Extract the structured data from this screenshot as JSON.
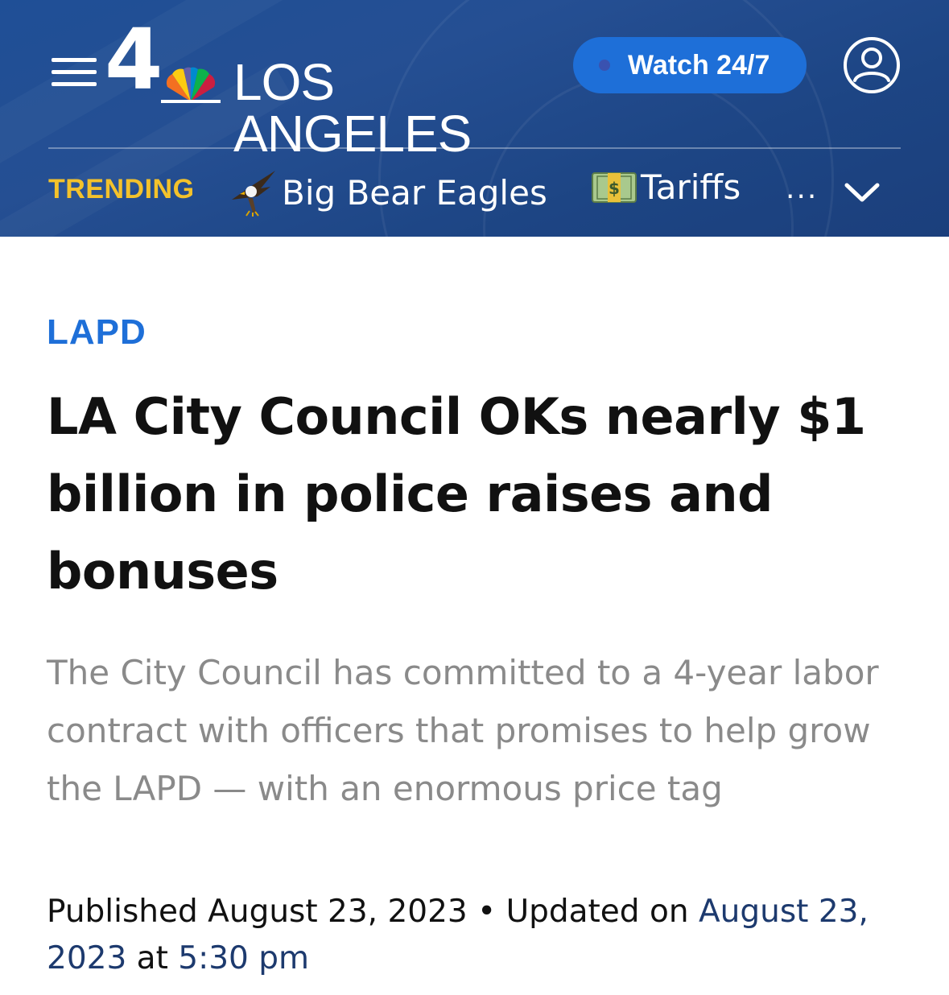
{
  "header": {
    "logo_number": "4",
    "logo_city": "LOS ANGELES",
    "watch_label": "Watch 24/7"
  },
  "trending": {
    "label": "TRENDING",
    "items": [
      {
        "label": "Big Bear Eagles",
        "icon": "eagle-icon"
      },
      {
        "label": "Tariffs",
        "icon": "money-icon"
      }
    ],
    "more": "..."
  },
  "article": {
    "category": "LAPD",
    "headline": "LA City Council OKs nearly $1 billion in police raises and bonuses",
    "summary": "The City Council has committed to a 4-year labor contract with officers that promises to help grow the LAPD — with an enormous price tag",
    "published_label": "Published",
    "published_date": "August 23, 2023",
    "separator": "•",
    "updated_label": "Updated on",
    "updated_date": "August 23, 2023",
    "at_label": "at",
    "updated_time": "5:30 pm"
  },
  "colors": {
    "header_bg": "#1f4f96",
    "accent_blue": "#1e6fd8",
    "trending_yellow": "#f4c22b",
    "date_blue": "#1d3a6e",
    "summary_gray": "#8a8a8a"
  }
}
